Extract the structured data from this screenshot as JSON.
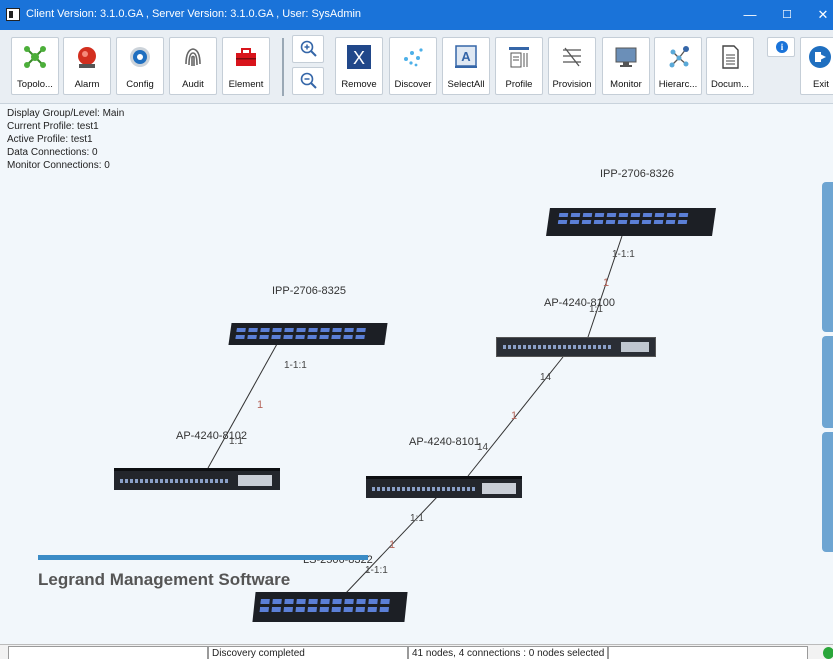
{
  "window": {
    "title": "Client  Version: 3.1.0.GA , Server Version: 3.1.0.GA , User: SysAdmin",
    "controls": [
      "—",
      "☐",
      "✕"
    ]
  },
  "toolbar": {
    "buttons": [
      {
        "label": "Topolo...",
        "icon": "topology-icon"
      },
      {
        "label": "Alarm",
        "icon": "alarm-icon"
      },
      {
        "label": "Config",
        "icon": "config-icon"
      },
      {
        "label": "Audit",
        "icon": "fingerprint-icon"
      },
      {
        "label": "Element",
        "icon": "toolbox-icon"
      },
      {
        "label": "Remove",
        "icon": "remove-icon"
      },
      {
        "label": "Discover",
        "icon": "discover-icon"
      },
      {
        "label": "SelectAll",
        "icon": "select-all-icon"
      },
      {
        "label": "Profile",
        "icon": "profile-icon"
      },
      {
        "label": "Provision",
        "icon": "provision-icon"
      },
      {
        "label": "Monitor",
        "icon": "monitor-icon"
      },
      {
        "label": "Hierarc...",
        "icon": "hierarchy-icon"
      },
      {
        "label": "Docum...",
        "icon": "document-icon"
      },
      {
        "label": "Exit",
        "icon": "exit-icon"
      }
    ],
    "zoom_in_icon": "zoom-in-icon",
    "zoom_out_icon": "zoom-out-icon",
    "info_icon": "info-icon"
  },
  "canvas": {
    "info": {
      "display_group": "Display Group/Level: Main",
      "current_profile": "Current Profile: test1",
      "active_profile": "Active Profile: test1",
      "data_connections": "Data Connections: 0",
      "monitor_connections": "Monitor Connections: 0"
    },
    "devices": {
      "ipp_8326": "IPP-2706-8326",
      "ipp_8325": "IPP-2706-8325",
      "ap_8100": "AP-4240-8100",
      "ap_8102": "AP-4240-8102",
      "ap_8101": "AP-4240-8101",
      "ls_8322": "LS-2506-8322"
    },
    "connections": {
      "c1_top": "1-1:1",
      "c1_bottom": "1:1",
      "c2_top": "1-1:1",
      "c2_bottom": "1:1",
      "c3_top": "14",
      "c3_bottom": "14",
      "c4_top": "1:1",
      "c4_bottom": "1-1:1",
      "mid": "1"
    },
    "brand": "Legrand Management Software"
  },
  "status": {
    "cell1": "",
    "cell2": "Discovery completed",
    "cell3": "41 nodes, 4 connections : 0 nodes selected",
    "cell4": ""
  },
  "colors": {
    "titlebar": "#1a73d9",
    "device_body": "#1c1f25",
    "port_blue": "#5b7fd6",
    "link_line": "#333333",
    "link_marker": "#b5655a",
    "brand_bar": "#3b8cc6"
  }
}
